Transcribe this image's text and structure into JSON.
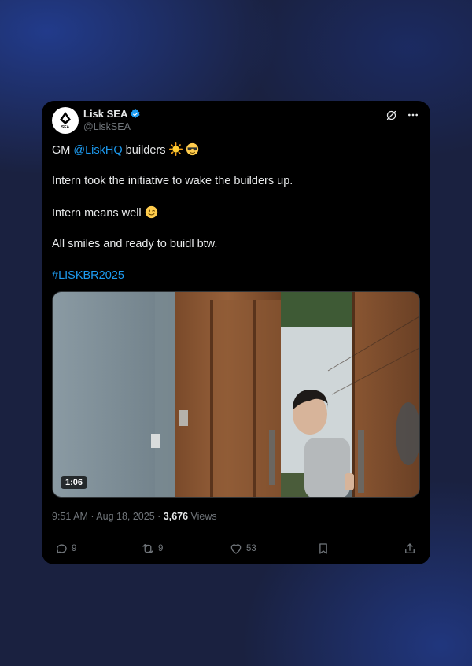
{
  "tweet": {
    "avatar_text": "SEA",
    "display_name": "Lisk SEA",
    "handle": "@LiskSEA",
    "line1_prefix": "GM ",
    "line1_mention": "@LiskHQ",
    "line1_suffix": " builders",
    "line2": "Intern took the initiative to wake the builders up.",
    "line3": "Intern means well",
    "line4": "All smiles and ready to buidl btw.",
    "hashtag": "#LISKBR2025",
    "video_duration": "1:06",
    "timestamp": "9:51 AM · Aug 18, 2025 · ",
    "views_count": "3,676",
    "views_label": " Views"
  },
  "actions": {
    "replies": "9",
    "reposts": "9",
    "likes": "53"
  },
  "colors": {
    "link": "#1d9bf0",
    "verified": "#1d9bf0",
    "card_bg": "#000000",
    "muted": "#71767b"
  },
  "icons": [
    "lisk-logo-icon",
    "verified-badge-icon",
    "grok-icon",
    "more-icon",
    "sun-emoji-icon",
    "sunglasses-emoji-icon",
    "wink-emoji-icon",
    "reply-icon",
    "repost-icon",
    "like-icon",
    "bookmark-icon",
    "share-icon"
  ]
}
